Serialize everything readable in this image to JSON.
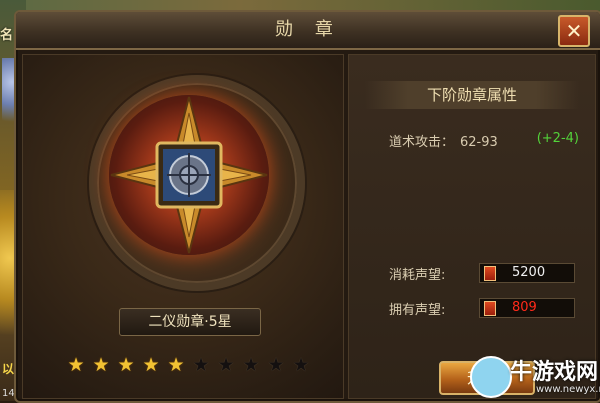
{
  "background": {
    "player_name_fragment": "名",
    "scroll_label": "以",
    "counter_text": "14"
  },
  "window": {
    "title": "勋 章",
    "close_label": "✕"
  },
  "medal": {
    "name": "二仪勋章·5星",
    "stars_total": 10,
    "stars_filled": 5
  },
  "next_tier": {
    "heading": "下阶勋章属性",
    "attribute_label": "道术攻击：",
    "attribute_value": "62-93",
    "attribute_delta": "(+2-4)"
  },
  "reputation": {
    "cost_label": "消耗声望:",
    "cost_value": "5200",
    "owned_label": "拥有声望:",
    "owned_value": "809"
  },
  "upgrade_button": {
    "label": "升"
  },
  "watermark": {
    "text": "牛游戏网",
    "url": "www.newyx.net"
  },
  "colors": {
    "star_on": "#f2c233",
    "star_off": "#141010",
    "delta_green": "#53d33a",
    "owned_red": "#ff2a1a",
    "title_gold": "#e6d6a8"
  }
}
